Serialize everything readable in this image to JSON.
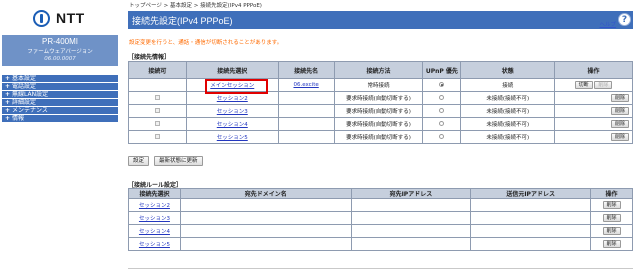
{
  "sidebar": {
    "logo_text": "NTT",
    "model": "PR-400MI",
    "firmware_label": "ファームウェアバージョン",
    "firmware_version": "06.00.0007",
    "menu": [
      {
        "label": "基本設定"
      },
      {
        "label": "電話設定"
      },
      {
        "label": "無線LAN設定"
      },
      {
        "label": "詳細設定"
      },
      {
        "label": "メンテナンス"
      },
      {
        "label": "情報"
      }
    ]
  },
  "breadcrumb": {
    "top": "トップページ",
    "sep1": " > ",
    "basic": "基本設定",
    "sep2": " > ",
    "current": "接続先設定(IPv4 PPPoE)"
  },
  "page": {
    "title": "接続先設定(IPv4 PPPoE)",
    "help_label": "ヘルプ",
    "help_icon": "?",
    "notice": "設定変更を行うと、通話・通信が切断されることがあります。"
  },
  "connections": {
    "section_title": "［接続先情報］",
    "headers": [
      "接続可",
      "接続先選択",
      "接続先名",
      "接続方法",
      "UPnP 優先",
      "状態",
      "操作"
    ],
    "rows": [
      {
        "select": "メインセッション",
        "name": "06.excite",
        "method": "常時接続",
        "status": "接続",
        "upnp_on": true,
        "op1": "切断",
        "op2": "削除",
        "enabled": true
      },
      {
        "select": "セッション2",
        "name": "",
        "method": "要求時接続(自動切断する)",
        "status": "未接続(接続不可)",
        "upnp_on": false,
        "op1": "",
        "op2": "削除",
        "enabled": false
      },
      {
        "select": "セッション3",
        "name": "",
        "method": "要求時接続(自動切断する)",
        "status": "未接続(接続不可)",
        "upnp_on": false,
        "op1": "",
        "op2": "削除",
        "enabled": false
      },
      {
        "select": "セッション4",
        "name": "",
        "method": "要求時接続(自動切断する)",
        "status": "未接続(接続不可)",
        "upnp_on": false,
        "op1": "",
        "op2": "削除",
        "enabled": false
      },
      {
        "select": "セッション5",
        "name": "",
        "method": "要求時接続(自動切断する)",
        "status": "未接続(接続不可)",
        "upnp_on": false,
        "op1": "",
        "op2": "削除",
        "enabled": false
      }
    ]
  },
  "buttons": {
    "settings": "設定",
    "refresh": "最新状態に更新"
  },
  "rules": {
    "section_title": "［接続ルール設定］",
    "headers": [
      "接続先選択",
      "宛先ドメイン名",
      "宛先IPアドレス",
      "送信元IPアドレス",
      "操作"
    ],
    "rows": [
      {
        "select": "セッション2",
        "op": "削除"
      },
      {
        "select": "セッション3",
        "op": "削除"
      },
      {
        "select": "セッション4",
        "op": "削除"
      },
      {
        "select": "セッション5",
        "op": "削除"
      }
    ]
  }
}
